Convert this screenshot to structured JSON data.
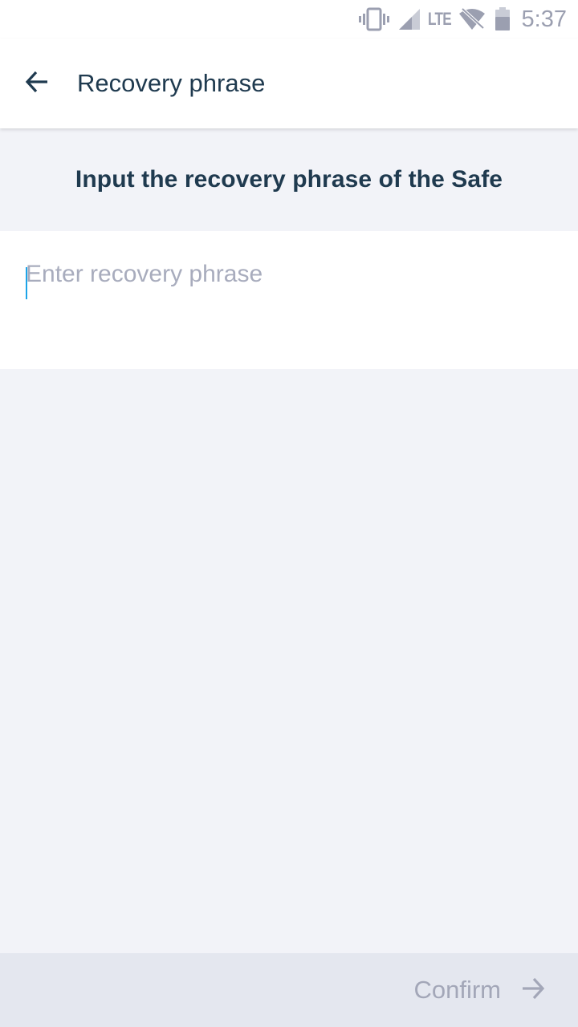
{
  "status_bar": {
    "network": "LTE",
    "time": "5:37",
    "icons": [
      "vibrate-icon",
      "cell-signal-icon",
      "wifi-off-icon",
      "battery-icon"
    ]
  },
  "app_bar": {
    "title": "Recovery phrase",
    "back_icon": "arrow-left-icon"
  },
  "header": {
    "text": "Input the recovery phrase of the Safe"
  },
  "input": {
    "placeholder": "Enter recovery phrase",
    "value": ""
  },
  "bottom_bar": {
    "confirm_label": "Confirm",
    "confirm_icon": "arrow-right-icon"
  },
  "colors": {
    "primary_text": "#1f3a4f",
    "placeholder": "#a8acbd",
    "background": "#f2f3f8",
    "caret": "#1ca4e8",
    "disabled": "#a3a7b8"
  }
}
